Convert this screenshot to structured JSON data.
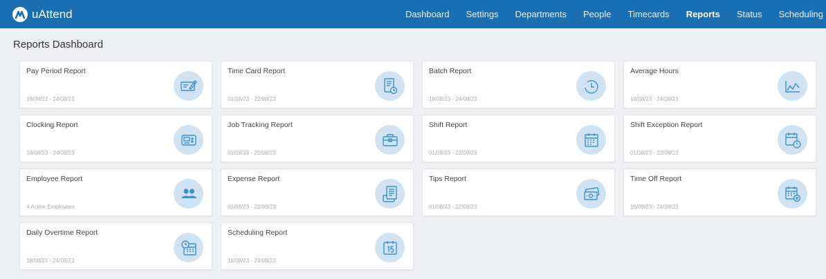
{
  "app": {
    "name": "uAttend"
  },
  "nav": {
    "items": [
      "Dashboard",
      "Settings",
      "Departments",
      "People",
      "Timecards",
      "Reports",
      "Status",
      "Scheduling"
    ],
    "active": "Reports"
  },
  "page": {
    "title": "Reports Dashboard"
  },
  "colors": {
    "header": "#1a6fb3",
    "icon_circle": "#cfe3f2",
    "icon_stroke": "#3e8fcf"
  },
  "cards": [
    {
      "title": "Pay Period Report",
      "subtitle": "18/08/23 - 24/08/23",
      "icon": "check-icon"
    },
    {
      "title": "Time Card Report",
      "subtitle": "01/08/23 - 22/08/23",
      "icon": "timecard-icon"
    },
    {
      "title": "Batch Report",
      "subtitle": "18/08/23 - 24/08/23",
      "icon": "clock-icon"
    },
    {
      "title": "Average Hours",
      "subtitle": "18/08/23 - 24/08/23",
      "icon": "chart-icon"
    },
    {
      "title": "Clocking Report",
      "subtitle": "18/08/23 - 24/08/23",
      "icon": "time-clock-icon"
    },
    {
      "title": "Job Tracking Report",
      "subtitle": "01/08/23 - 22/08/23",
      "icon": "briefcase-icon"
    },
    {
      "title": "Shift Report",
      "subtitle": "01/08/23 - 22/08/23",
      "icon": "calendar-icon"
    },
    {
      "title": "Shift Exception Report",
      "subtitle": "01/08/23 - 22/08/23",
      "icon": "calendar-alert-icon"
    },
    {
      "title": "Employee Report",
      "subtitle": "4 Active Employees",
      "icon": "people-icon"
    },
    {
      "title": "Expense Report",
      "subtitle": "01/08/23 - 22/08/23",
      "icon": "receipt-icon"
    },
    {
      "title": "Tips Report",
      "subtitle": "01/08/23 - 22/08/23",
      "icon": "money-icon"
    },
    {
      "title": "Time Off Report",
      "subtitle": "18/08/23 - 24/08/23",
      "icon": "calendar-cancel-icon"
    },
    {
      "title": "Daily Overtime Report",
      "subtitle": "18/08/23 - 24/08/23",
      "icon": "overtime-icon"
    },
    {
      "title": "Scheduling Report",
      "subtitle": "18/08/23 - 24/08/23",
      "icon": "calendar-15-icon"
    }
  ]
}
